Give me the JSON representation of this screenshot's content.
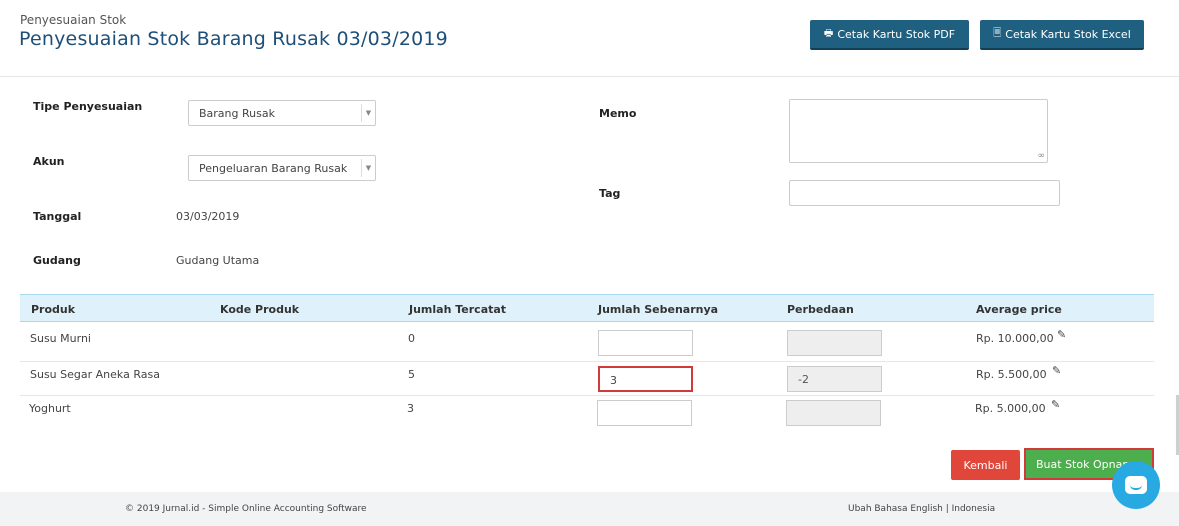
{
  "header": {
    "breadcrumb": "Penyesuaian Stok",
    "title": "Penyesuaian Stok Barang Rusak 03/03/2019",
    "btn_pdf": "Cetak Kartu Stok PDF",
    "btn_excel": "Cetak Kartu Stok Excel"
  },
  "form": {
    "tipe_label": "Tipe Penyesuaian",
    "tipe_value": "Barang Rusak",
    "akun_label": "Akun",
    "akun_value": "Pengeluaran Barang Rusak",
    "tanggal_label": "Tanggal",
    "tanggal_value": "03/03/2019",
    "gudang_label": "Gudang",
    "gudang_value": "Gudang Utama",
    "memo_label": "Memo",
    "memo_value": "",
    "tag_label": "Tag",
    "tag_value": ""
  },
  "table": {
    "headers": [
      "Produk",
      "Kode Produk",
      "Jumlah Tercatat",
      "Jumlah Sebenarnya",
      "Perbedaan",
      "Average price"
    ],
    "rows": [
      {
        "produk": "Susu Murni",
        "kode": "",
        "tercatat": "0",
        "sebenarnya": "",
        "perbedaan": "",
        "price": "Rp. 10.000,00"
      },
      {
        "produk": "Susu Segar Aneka Rasa",
        "kode": "",
        "tercatat": "5",
        "sebenarnya": "3",
        "perbedaan": "-2",
        "price": "Rp. 5.500,00"
      },
      {
        "produk": "Yoghurt",
        "kode": "",
        "tercatat": "3",
        "sebenarnya": "",
        "perbedaan": "",
        "price": "Rp. 5.000,00"
      }
    ]
  },
  "actions": {
    "back": "Kembali",
    "create": "Buat Stok Opname"
  },
  "footer": {
    "copyright": "© 2019 Jurnal.id - Simple Online Accounting Software",
    "language": "Ubah Bahasa English | Indonesia"
  },
  "icons": {
    "print": "printer-icon",
    "excel": "file-excel-icon",
    "edit": "pencil-icon",
    "chat": "chat-icon"
  },
  "colors": {
    "title": "#1e4f78",
    "header_button": "#1f5f7f",
    "back_button": "#e0463a",
    "create_button": "#4cae4c",
    "highlight_border": "#d03a3a",
    "table_header_bg": "#dff2fb",
    "chat": "#29a9e1"
  }
}
